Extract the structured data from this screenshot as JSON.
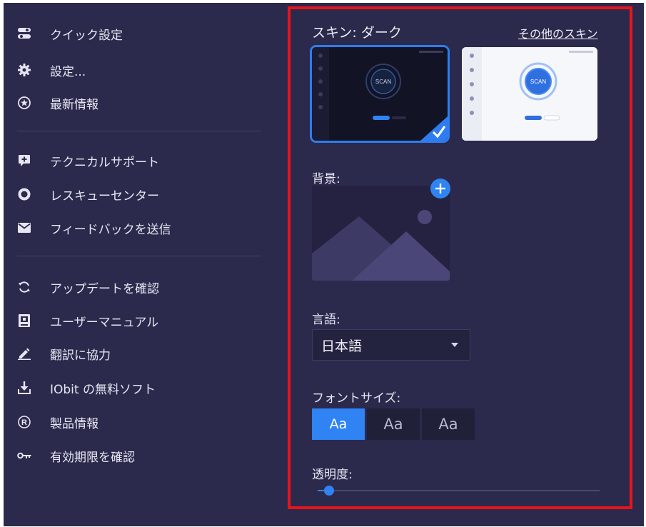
{
  "menu": {
    "group1": [
      {
        "icon": "toggle-icon",
        "label": "クイック設定"
      },
      {
        "icon": "gear-icon",
        "label": "設定..."
      },
      {
        "icon": "star-circle-icon",
        "label": "最新情報"
      }
    ],
    "group2": [
      {
        "icon": "support-chat-icon",
        "label": "テクニカルサポート"
      },
      {
        "icon": "rescue-ring-icon",
        "label": "レスキューセンター"
      },
      {
        "icon": "mail-icon",
        "label": "フィードバックを送信"
      }
    ],
    "group3": [
      {
        "icon": "refresh-icon",
        "label": "アップデートを確認"
      },
      {
        "icon": "manual-book-icon",
        "label": "ユーザーマニュアル"
      },
      {
        "icon": "pencil-icon",
        "label": "翻訳に協力"
      },
      {
        "icon": "download-icon",
        "label": "IObit の無料ソフト"
      },
      {
        "icon": "registered-icon",
        "label": "製品情報"
      },
      {
        "icon": "key-icon",
        "label": "有効期限を確認"
      }
    ]
  },
  "settings": {
    "skin_title": "スキン: ダーク",
    "more_skins": "その他のスキン",
    "skins": [
      {
        "name": "dark",
        "selected": true,
        "scan_text": "SCAN"
      },
      {
        "name": "light",
        "selected": false,
        "scan_text": "SCAN"
      }
    ],
    "background_label": "背景:",
    "language_label": "言語:",
    "language_value": "日本語",
    "font_size_label": "フォントサイズ:",
    "font_sizes": [
      "Aa",
      "Aa",
      "Aa"
    ],
    "font_size_selected": 0,
    "transparency_label": "透明度:",
    "transparency_value": 0.04
  },
  "colors": {
    "background": "#2b2a4c",
    "accent": "#2f83f2",
    "highlight": "#e8141a"
  }
}
